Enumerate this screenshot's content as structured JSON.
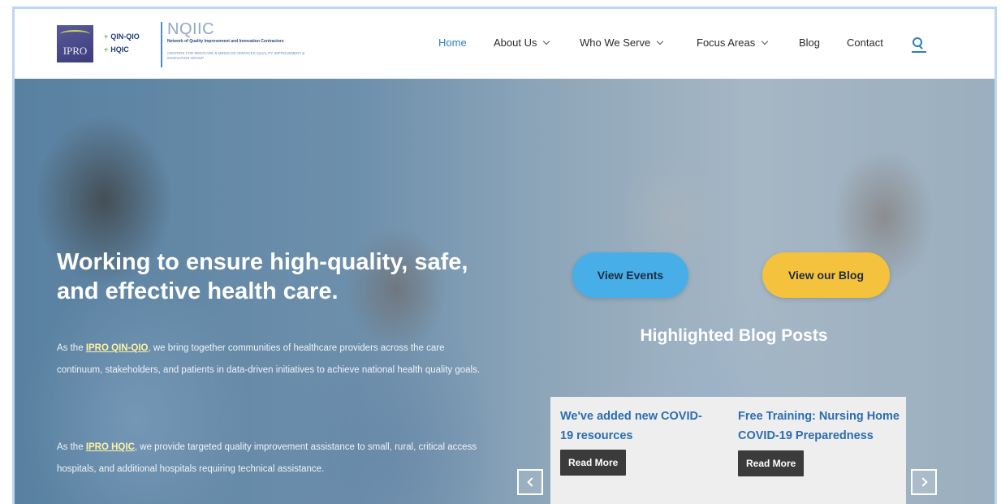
{
  "logo": {
    "ipro_text": "IPRO",
    "qin_qio": "QIN-QIO",
    "hqic": "HQIC",
    "nqiic_title": "NQIIC",
    "nqiic_subtitle": "Network of Quality Improvement and Innovation Contractors",
    "nqiic_subtitle2": "CENTERS FOR MEDICARE & MEDICAID SERVICES IQUALITY IMPROVEMENT & INNOVATION GROUP"
  },
  "nav": {
    "home": "Home",
    "about": "About Us",
    "who_we_serve": "Who We Serve",
    "focus_areas": "Focus Areas",
    "blog": "Blog",
    "contact": "Contact"
  },
  "hero": {
    "title": "Working to ensure high-quality, safe, and effective health care.",
    "p1_prefix": "As the ",
    "p1_link": "IPRO QIN-QIO",
    "p1_suffix": ", we bring together communities of healthcare providers across the care continuum, stakeholders, and patients in data-driven initiatives to achieve national health quality goals.",
    "p2_prefix": "As the ",
    "p2_link": "IPRO HQIC",
    "p2_suffix": ", we provide targeted quality improvement assistance to small, rural, critical access hospitals, and additional hospitals requiring technical assistance."
  },
  "buttons": {
    "view_events": "View Events",
    "view_blog": "View our Blog"
  },
  "highlighted": {
    "title": "Highlighted Blog Posts",
    "posts": [
      {
        "title": "We've added new COVID-19 resources",
        "read_more": "Read More"
      },
      {
        "title": "Free Training: Nursing Home COVID-19 Preparedness",
        "read_more": "Read More"
      }
    ]
  },
  "colors": {
    "nav_active": "#2d7fc1",
    "events_button": "#48aee8",
    "blog_button": "#f5c23e",
    "post_title": "#2b6db3",
    "read_more_bg": "#3b3b3b"
  }
}
